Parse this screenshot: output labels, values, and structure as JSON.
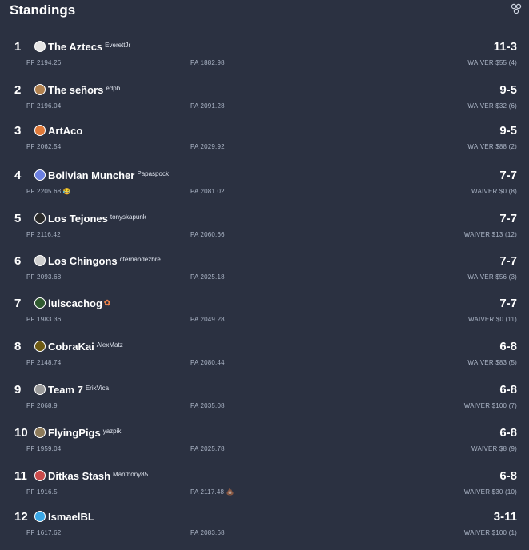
{
  "header": {
    "title": "Standings"
  },
  "rows": [
    {
      "rank": "1",
      "team": "The Aztecs",
      "owner": "EverettJr",
      "record": "11-3",
      "pf": "PF 2194.26",
      "pa": "PA 1882.98",
      "waiver": "WAIVER $55 (4)",
      "avatar_color": "#e5e5e5"
    },
    {
      "rank": "2",
      "team": "The señors",
      "owner": "edpb",
      "record": "9-5",
      "pf": "PF 2196.04",
      "pa": "PA 2091.28",
      "waiver": "WAIVER $32 (6)",
      "avatar_color": "#b0814f"
    },
    {
      "rank": "3",
      "team": "ArtAco",
      "owner": "",
      "record": "9-5",
      "pf": "PF 2062.54",
      "pa": "PA 2029.92",
      "waiver": "WAIVER $88 (2)",
      "avatar_color": "#e07a3a"
    },
    {
      "rank": "4",
      "team": "Bolivian Muncher",
      "owner": "Papaspock",
      "record": "7-7",
      "pf": "PF 2205.68 😂",
      "pa": "PA 2081.02",
      "waiver": "WAIVER $0 (8)",
      "avatar_color": "#6b7fe0"
    },
    {
      "rank": "5",
      "team": "Los Tejones",
      "owner": "tonyskapunk",
      "record": "7-7",
      "pf": "PF 2116.42",
      "pa": "PA 2060.66",
      "waiver": "WAIVER $13 (12)",
      "avatar_color": "#2a2a2a"
    },
    {
      "rank": "6",
      "team": "Los Chingons",
      "owner": "cfernandezbre",
      "record": "7-7",
      "pf": "PF 2093.68",
      "pa": "PA 2025.18",
      "waiver": "WAIVER $56 (3)",
      "avatar_color": "#cfcfcf"
    },
    {
      "rank": "7",
      "team": "luiscachog",
      "owner": "",
      "record": "7-7",
      "pf": "PF 1983.36",
      "pa": "PA 2049.28",
      "waiver": "WAIVER $0 (11)",
      "avatar_color": "#2f5a2f"
    },
    {
      "rank": "8",
      "team": "CobraKai",
      "owner": "AlexMatz",
      "record": "6-8",
      "pf": "PF 2148.74",
      "pa": "PA 2080.44",
      "waiver": "WAIVER $83 (5)",
      "avatar_color": "#6e5b14"
    },
    {
      "rank": "9",
      "team": "Team 7",
      "owner": "ErikVica",
      "record": "6-8",
      "pf": "PF 2068.9",
      "pa": "PA 2035.08",
      "waiver": "WAIVER $100 (7)",
      "avatar_color": "#9a9a9a"
    },
    {
      "rank": "10",
      "team": "FlyingPigs",
      "owner": "yazpik",
      "record": "6-8",
      "pf": "PF 1959.04",
      "pa": "PA 2025.78",
      "waiver": "WAIVER $8 (9)",
      "avatar_color": "#8c7a5a"
    },
    {
      "rank": "11",
      "team": "Ditkas Stash",
      "owner": "Manthony85",
      "record": "6-8",
      "pf": "PF 1916.5",
      "pa": "PA 2117.48 💩",
      "waiver": "WAIVER $30 (10)",
      "avatar_color": "#c94b4b"
    },
    {
      "rank": "12",
      "team": "IsmaelBL",
      "owner": "",
      "record": "3-11",
      "pf": "PF 1617.62",
      "pa": "PA 2083.68",
      "waiver": "WAIVER $100 (1)",
      "avatar_color": "#3aa7e6"
    }
  ]
}
